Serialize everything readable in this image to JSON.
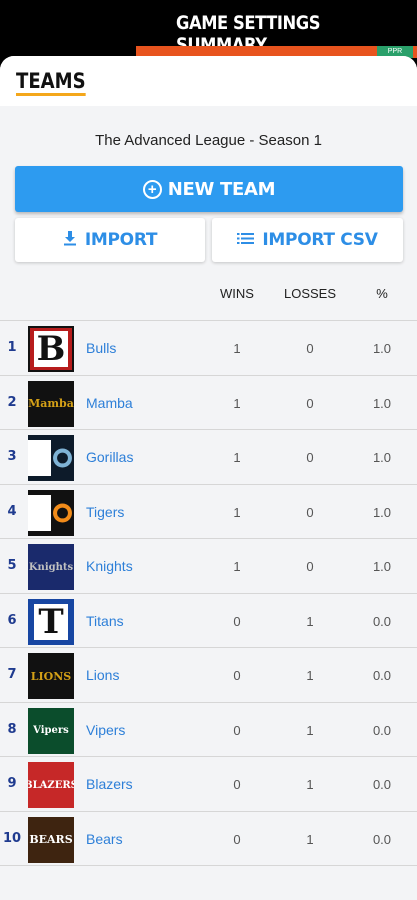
{
  "background": {
    "title": "GAME SETTINGS SUMMARY",
    "badge_text": "PPR",
    "accent_color": "#e8541e"
  },
  "sheet": {
    "title": "TEAMS",
    "title_underline_color": "#f4a71b",
    "league_name": "The Advanced League - Season 1"
  },
  "actions": {
    "new_team": {
      "label": "NEW TEAM",
      "icon": "plus-circle-icon"
    },
    "import": {
      "label": "IMPORT",
      "icon": "download-icon"
    },
    "import_csv": {
      "label": "IMPORT CSV",
      "icon": "list-icon"
    }
  },
  "table": {
    "columns": {
      "wins": "WINS",
      "losses": "LOSSES",
      "pct": "%"
    },
    "rows": [
      {
        "rank": "1",
        "name": "Bulls",
        "wins": "1",
        "losses": "0",
        "pct": "1.0",
        "logo": {
          "text": "B",
          "bg": "#b71c1c",
          "fg": "#111",
          "border": "#111"
        }
      },
      {
        "rank": "2",
        "name": "Mamba",
        "wins": "1",
        "losses": "0",
        "pct": "1.0",
        "logo": {
          "text": "Mamba",
          "bg": "#111",
          "fg": "#d4a017"
        }
      },
      {
        "rank": "3",
        "name": "Gorillas",
        "wins": "1",
        "losses": "0",
        "pct": "1.0",
        "logo": {
          "text": "",
          "bg": "#0d1b2a",
          "fg": "#7fb3d5"
        }
      },
      {
        "rank": "4",
        "name": "Tigers",
        "wins": "1",
        "losses": "0",
        "pct": "1.0",
        "logo": {
          "text": "",
          "bg": "#111",
          "fg": "#f28c1a"
        }
      },
      {
        "rank": "5",
        "name": "Knights",
        "wins": "1",
        "losses": "0",
        "pct": "1.0",
        "logo": {
          "text": "Knights",
          "bg": "#1a2a6c",
          "fg": "#c0c0c0"
        }
      },
      {
        "rank": "6",
        "name": "Titans",
        "wins": "0",
        "losses": "1",
        "pct": "0.0",
        "logo": {
          "text": "T",
          "bg": "#1746a2",
          "fg": "#111"
        }
      },
      {
        "rank": "7",
        "name": "Lions",
        "wins": "0",
        "losses": "1",
        "pct": "0.0",
        "logo": {
          "text": "LIONS",
          "bg": "#111",
          "fg": "#d4a017"
        }
      },
      {
        "rank": "8",
        "name": "Vipers",
        "wins": "0",
        "losses": "1",
        "pct": "0.0",
        "logo": {
          "text": "Vipers",
          "bg": "#0b4d2c",
          "fg": "#ffffff"
        }
      },
      {
        "rank": "9",
        "name": "Blazers",
        "wins": "0",
        "losses": "1",
        "pct": "0.0",
        "logo": {
          "text": "BLAZERS",
          "bg": "#c62828",
          "fg": "#ffffff"
        }
      },
      {
        "rank": "10",
        "name": "Bears",
        "wins": "0",
        "losses": "1",
        "pct": "0.0",
        "logo": {
          "text": "BEARS",
          "bg": "#3e2410",
          "fg": "#ffffff"
        }
      }
    ]
  }
}
